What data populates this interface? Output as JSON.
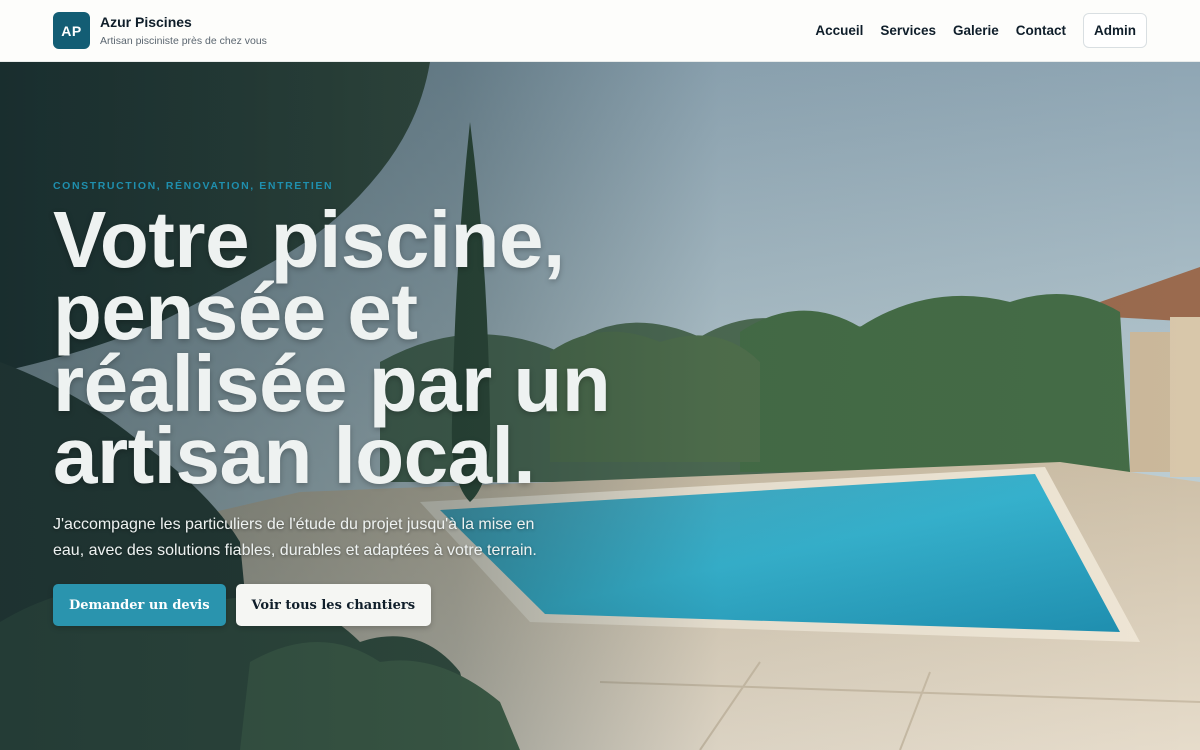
{
  "brand": {
    "initials": "AP",
    "name": "Azur Piscines",
    "tagline": "Artisan pisciniste près de chez vous",
    "badge_color": "#135d74"
  },
  "nav": {
    "items": [
      "Accueil",
      "Services",
      "Galerie",
      "Contact"
    ],
    "admin_label": "Admin"
  },
  "hero": {
    "eyebrow": "CONSTRUCTION, RÉNOVATION, ENTRETIEN",
    "headline_lines": [
      "Votre piscine,",
      "pensée et",
      "réalisée par un",
      "artisan local."
    ],
    "lead": "J'accompagne les particuliers de l'étude du projet jusqu'à la mise en eau, avec des solutions fiables, durables et adaptées à votre terrain.",
    "cta_primary": "Demander un devis",
    "cta_secondary": "Voir tous les chantiers",
    "image_subject": "pool-garden-photo",
    "accent_color": "#2a94ae"
  }
}
